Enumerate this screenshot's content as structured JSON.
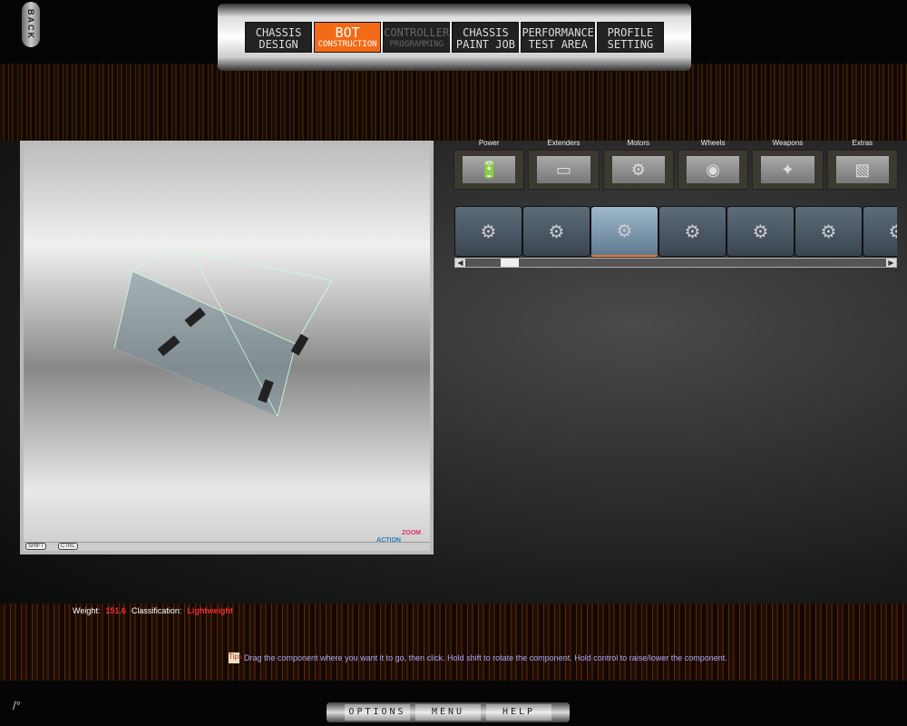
{
  "back_label": "BACK",
  "top_tabs": [
    {
      "line1": "CHASSIS",
      "line2": "DESIGN",
      "state": "normal"
    },
    {
      "line1": "BOT",
      "line2": "CONSTRUCTION",
      "state": "active"
    },
    {
      "line1": "CONTROLLER",
      "line2": "PROGRAMMING",
      "state": "disabled"
    },
    {
      "line1": "CHASSIS",
      "line2": "PAINT JOB",
      "state": "normal"
    },
    {
      "line1": "PERFORMANCE",
      "line2": "TEST AREA",
      "state": "normal"
    },
    {
      "line1": "PROFILE",
      "line2": "SETTING",
      "state": "normal"
    }
  ],
  "accent": "#f36a16",
  "categories": [
    {
      "label": "Power",
      "icon": "battery-icon"
    },
    {
      "label": "Extenders",
      "icon": "extender-bar-icon"
    },
    {
      "label": "Motors",
      "icon": "motor-icon"
    },
    {
      "label": "Wheels",
      "icon": "wheel-icon"
    },
    {
      "label": "Weapons",
      "icon": "weapon-icon"
    },
    {
      "label": "Extras",
      "icon": "extras-icon"
    }
  ],
  "parts": [
    "motor-1",
    "motor-2",
    "motor-3",
    "motor-4",
    "motor-5",
    "motor-6",
    "motor-7"
  ],
  "selected_part_index": 2,
  "viewport": {
    "shift_key": "SHIFT",
    "ctrl_key": "CTRL",
    "action_label": "ACTION",
    "zoom_label": "ZOOM"
  },
  "stats": {
    "weight_label": "Weight:",
    "weight_value": "151.6",
    "class_label": "Classification:",
    "class_value": "Lightweight"
  },
  "hint": {
    "icon_text": "Tips",
    "text": "Drag the component where you want it to go, then click. Hold shift to rotate the component. Hold control to raise/lower the component."
  },
  "bottom_nav": [
    "OPTIONS",
    "MENU",
    "HELP"
  ],
  "corner_glyph": "/°"
}
